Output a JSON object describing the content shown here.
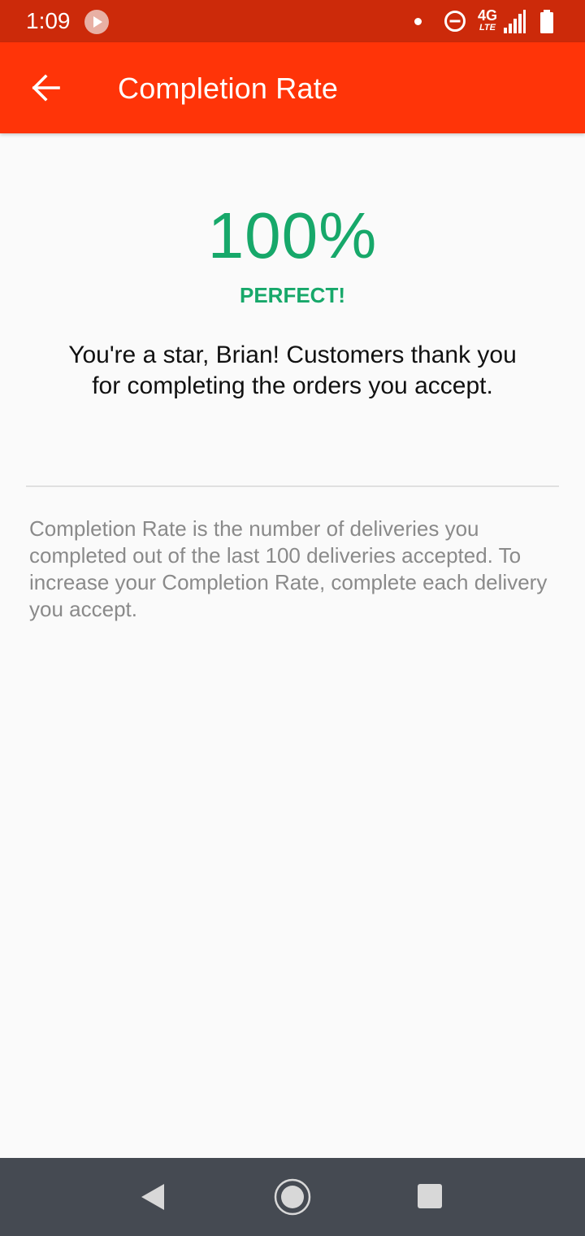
{
  "status_bar": {
    "time": "1:09",
    "network_label": "4G",
    "network_sublabel": "LTE"
  },
  "app_bar": {
    "title": "Completion Rate"
  },
  "summary": {
    "rate": "100%",
    "rating_label": "PERFECT!",
    "message": "You're a star, Brian! Customers thank you for completing the orders you accept."
  },
  "explanation": {
    "text": "Completion Rate is the number of deliveries you completed out of the last 100 deliveries accepted. To increase your Completion Rate, complete each delivery you accept."
  },
  "colors": {
    "status_bar": "#cc2a0a",
    "app_bar": "#ff3408",
    "accent_green": "#17a86a",
    "nav_bar": "#454a52"
  }
}
